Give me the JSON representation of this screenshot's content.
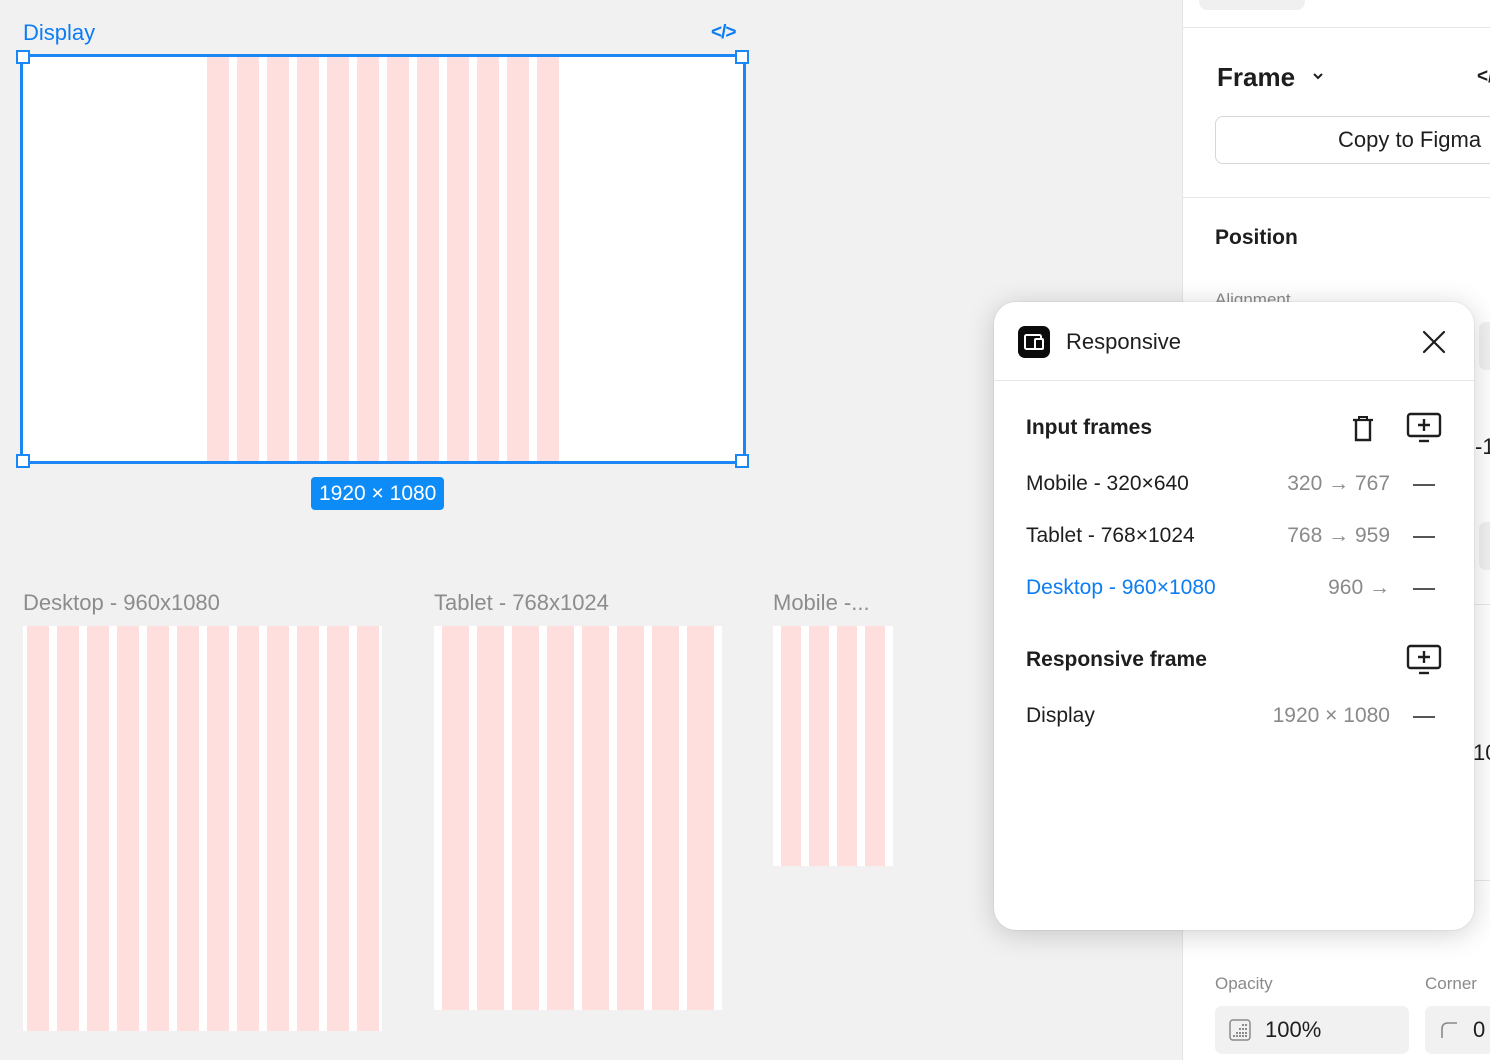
{
  "canvas": {
    "selected_frame": {
      "label": "Display",
      "code_icon": "</>",
      "size_badge": "1920 × 1080"
    },
    "frames": [
      {
        "label": "Desktop - 960x1080"
      },
      {
        "label": "Tablet - 768x1024"
      },
      {
        "label": "Mobile -..."
      }
    ]
  },
  "properties_panel": {
    "frame_title": "Frame",
    "code_icon": "</",
    "copy_button": "Copy to Figma",
    "position_title": "Position",
    "alignment_label": "Alignment",
    "hidden_value_1": "-1",
    "hidden_value_2": "10",
    "opacity_label": "Opacity",
    "opacity_value": "100%",
    "corner_label": "Corner",
    "corner_value": "0"
  },
  "responsive_popover": {
    "title": "Responsive",
    "input_frames_title": "Input frames",
    "input_frames": [
      {
        "name": "Mobile - 320×640",
        "range": "320 → 767",
        "active": false
      },
      {
        "name": "Tablet - 768×1024",
        "range": "768 → 959",
        "active": false
      },
      {
        "name": "Desktop - 960×1080",
        "range": "960 →",
        "active": true
      }
    ],
    "responsive_frame_title": "Responsive frame",
    "responsive_frames": [
      {
        "name": "Display",
        "size": "1920 × 1080"
      }
    ]
  },
  "colors": {
    "accent": "#0d7df2",
    "selection": "#1b87f5",
    "grid_column": "#ffdede",
    "canvas_bg": "#f1f1f1"
  },
  "icons": {
    "popover_app": "responsive-app-icon",
    "close": "close-icon",
    "delete": "trash-icon",
    "add_frame": "add-frame-icon",
    "remove": "minus-icon",
    "opacity": "opacity-grid-icon",
    "corner": "corner-radius-icon"
  }
}
